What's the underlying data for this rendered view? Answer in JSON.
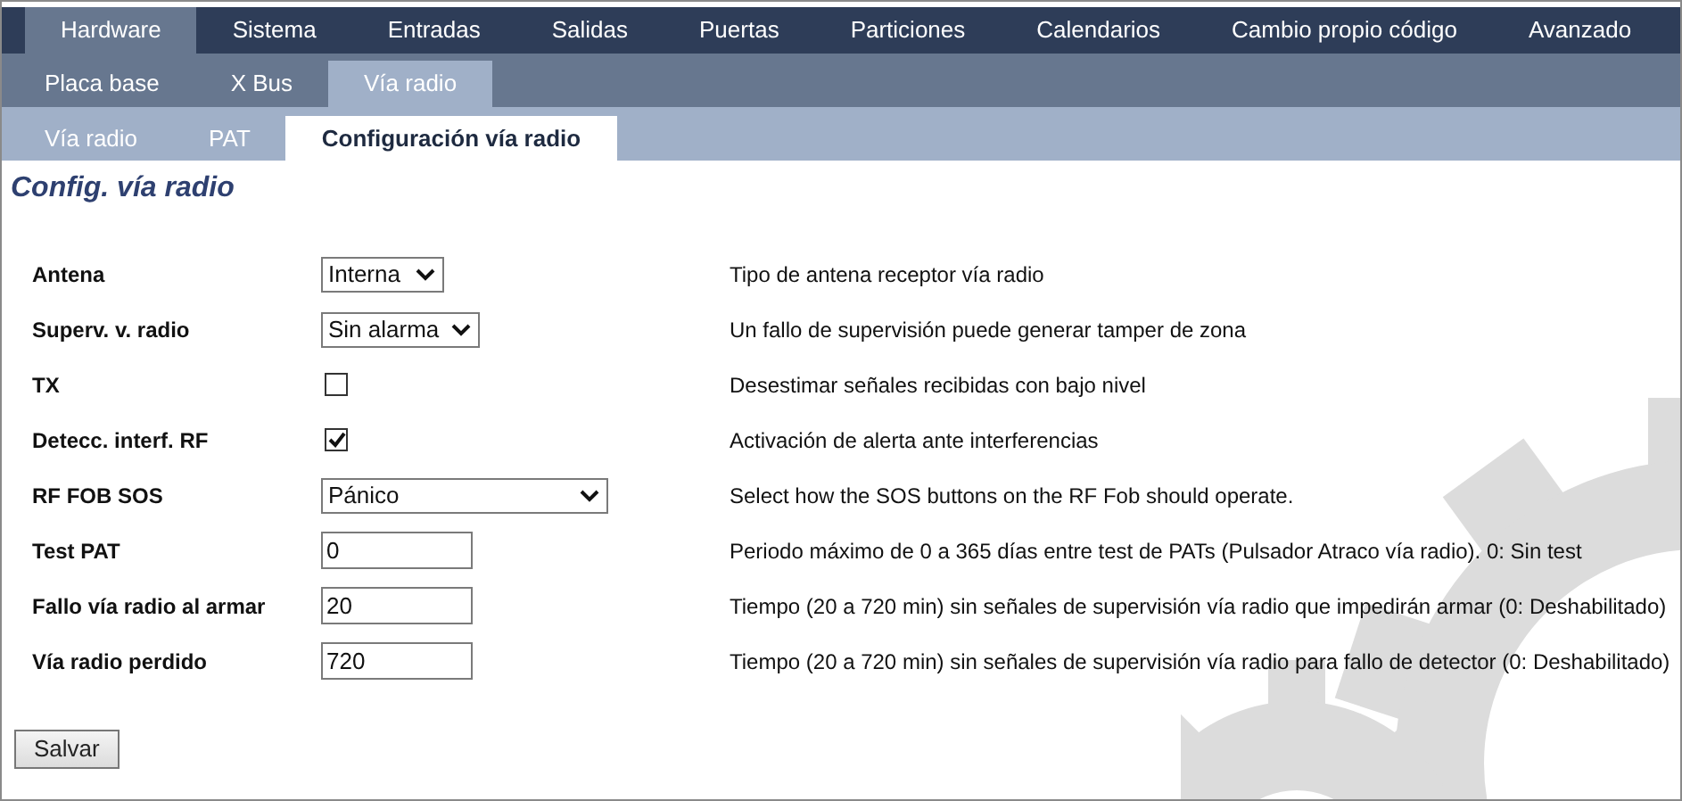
{
  "main_tabs": [
    {
      "label": "Hardware",
      "selected": true
    },
    {
      "label": "Sistema",
      "selected": false
    },
    {
      "label": "Entradas",
      "selected": false
    },
    {
      "label": "Salidas",
      "selected": false
    },
    {
      "label": "Puertas",
      "selected": false
    },
    {
      "label": "Particiones",
      "selected": false
    },
    {
      "label": "Calendarios",
      "selected": false
    },
    {
      "label": "Cambio propio código",
      "selected": false
    },
    {
      "label": "Avanzado",
      "selected": false
    }
  ],
  "sub_tabs": [
    {
      "label": "Placa base",
      "selected": false
    },
    {
      "label": "X Bus",
      "selected": false
    },
    {
      "label": "Vía radio",
      "selected": true
    }
  ],
  "section_tabs": [
    {
      "label": "Vía radio",
      "selected": false
    },
    {
      "label": "PAT",
      "selected": false
    },
    {
      "label": "Configuración vía radio",
      "selected": true
    }
  ],
  "page_title": "Config. vía radio",
  "fields": [
    {
      "kind": "select",
      "label": "Antena",
      "value": "Interna",
      "description": "Tipo de antena receptor vía radio"
    },
    {
      "kind": "select",
      "label": "Superv. v. radio",
      "value": "Sin alarma",
      "description": "Un fallo de supervisión puede generar tamper de zona"
    },
    {
      "kind": "checkbox",
      "label": "TX",
      "checked": false,
      "description": "Desestimar señales recibidas con bajo nivel"
    },
    {
      "kind": "checkbox",
      "label": "Detecc. interf. RF",
      "checked": true,
      "description": "Activación de alerta ante interferencias"
    },
    {
      "kind": "select",
      "label": "RF FOB SOS",
      "value": "Pánico",
      "description": "Select how the SOS buttons on the RF Fob should operate."
    },
    {
      "kind": "text",
      "label": "Test PAT",
      "value": "0",
      "description": "Periodo máximo de 0 a 365 días entre test de PATs (Pulsador Atraco vía radio). 0: Sin test"
    },
    {
      "kind": "text",
      "label": "Fallo vía radio al armar",
      "value": "20",
      "description": "Tiempo (20 a 720 min) sin señales de supervisión vía radio que impedirán armar (0: Deshabilitado)"
    },
    {
      "kind": "text",
      "label": "Vía radio perdido",
      "value": "720",
      "description": "Tiempo (20 a 720 min) sin señales de supervisión vía radio para fallo de detector (0: Deshabilitado)"
    }
  ],
  "save_button": "Salvar"
}
